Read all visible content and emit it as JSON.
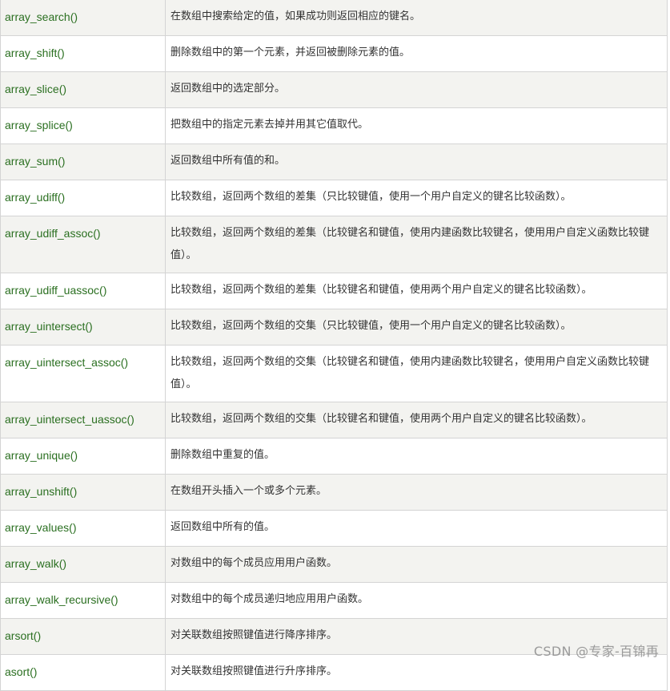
{
  "rows": [
    {
      "name": "array_search()",
      "desc": "在数组中搜索给定的值，如果成功则返回相应的键名。"
    },
    {
      "name": "array_shift()",
      "desc": "删除数组中的第一个元素，并返回被删除元素的值。"
    },
    {
      "name": "array_slice()",
      "desc": "返回数组中的选定部分。"
    },
    {
      "name": "array_splice()",
      "desc": "把数组中的指定元素去掉并用其它值取代。"
    },
    {
      "name": "array_sum()",
      "desc": "返回数组中所有值的和。"
    },
    {
      "name": "array_udiff()",
      "desc": "比较数组，返回两个数组的差集（只比较键值，使用一个用户自定义的键名比较函数）。"
    },
    {
      "name": "array_udiff_assoc()",
      "desc": "比较数组，返回两个数组的差集（比较键名和键值，使用内建函数比较键名，使用用户自定义函数比较键值）。"
    },
    {
      "name": "array_udiff_uassoc()",
      "desc": "比较数组，返回两个数组的差集（比较键名和键值，使用两个用户自定义的键名比较函数）。"
    },
    {
      "name": "array_uintersect()",
      "desc": "比较数组，返回两个数组的交集（只比较键值，使用一个用户自定义的键名比较函数）。"
    },
    {
      "name": "array_uintersect_assoc()",
      "desc": "比较数组，返回两个数组的交集（比较键名和键值，使用内建函数比较键名，使用用户自定义函数比较键值）。"
    },
    {
      "name": "array_uintersect_uassoc()",
      "desc": "比较数组，返回两个数组的交集（比较键名和键值，使用两个用户自定义的键名比较函数）。"
    },
    {
      "name": "array_unique()",
      "desc": "删除数组中重复的值。"
    },
    {
      "name": "array_unshift()",
      "desc": "在数组开头插入一个或多个元素。"
    },
    {
      "name": "array_values()",
      "desc": "返回数组中所有的值。"
    },
    {
      "name": "array_walk()",
      "desc": "对数组中的每个成员应用用户函数。"
    },
    {
      "name": "array_walk_recursive()",
      "desc": "对数组中的每个成员递归地应用用户函数。"
    },
    {
      "name": "arsort()",
      "desc": "对关联数组按照键值进行降序排序。"
    },
    {
      "name": "asort()",
      "desc": "对关联数组按照键值进行升序排序。"
    }
  ],
  "watermark": "CSDN @专家-百锦再",
  "colors": {
    "link": "#2a6f20",
    "alt_row": "#f3f3f0",
    "border": "#d4d4d4",
    "text": "#333333"
  }
}
